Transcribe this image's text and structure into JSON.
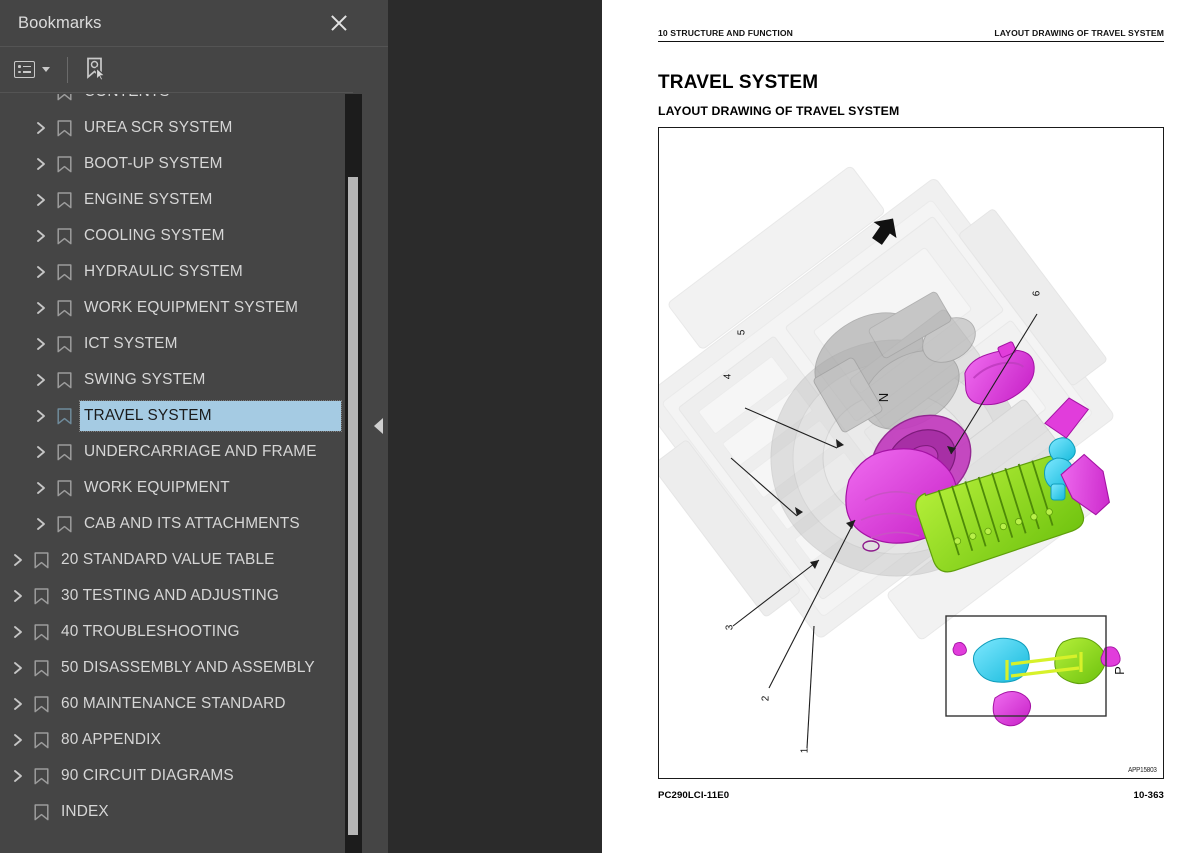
{
  "sidebar": {
    "title": "Bookmarks",
    "close_icon": "close-icon",
    "toolbar": {
      "options_icon": "list-options-icon",
      "caret_icon": "chevron-down-icon",
      "new_bookmark_icon": "new-bookmark-icon"
    },
    "items": [
      {
        "label": "CONTENTS",
        "level": 2,
        "expandable": false,
        "selected": false,
        "clipped": true
      },
      {
        "label": "UREA SCR SYSTEM",
        "level": 2,
        "expandable": true,
        "selected": false
      },
      {
        "label": "BOOT-UP SYSTEM",
        "level": 2,
        "expandable": true,
        "selected": false
      },
      {
        "label": "ENGINE SYSTEM",
        "level": 2,
        "expandable": true,
        "selected": false
      },
      {
        "label": "COOLING SYSTEM",
        "level": 2,
        "expandable": true,
        "selected": false
      },
      {
        "label": "HYDRAULIC SYSTEM",
        "level": 2,
        "expandable": true,
        "selected": false
      },
      {
        "label": "WORK EQUIPMENT SYSTEM",
        "level": 2,
        "expandable": true,
        "selected": false
      },
      {
        "label": "ICT SYSTEM",
        "level": 2,
        "expandable": true,
        "selected": false
      },
      {
        "label": "SWING SYSTEM",
        "level": 2,
        "expandable": true,
        "selected": false
      },
      {
        "label": "TRAVEL SYSTEM",
        "level": 2,
        "expandable": true,
        "selected": true
      },
      {
        "label": "UNDERCARRIAGE AND FRAME",
        "level": 2,
        "expandable": true,
        "selected": false
      },
      {
        "label": "WORK EQUIPMENT",
        "level": 2,
        "expandable": true,
        "selected": false
      },
      {
        "label": "CAB AND ITS ATTACHMENTS",
        "level": 2,
        "expandable": true,
        "selected": false
      },
      {
        "label": "20 STANDARD VALUE TABLE",
        "level": 1,
        "expandable": true,
        "selected": false
      },
      {
        "label": "30 TESTING AND ADJUSTING",
        "level": 1,
        "expandable": true,
        "selected": false
      },
      {
        "label": "40 TROUBLESHOOTING",
        "level": 1,
        "expandable": true,
        "selected": false
      },
      {
        "label": "50 DISASSEMBLY AND ASSEMBLY",
        "level": 1,
        "expandable": true,
        "selected": false
      },
      {
        "label": "60 MAINTENANCE STANDARD",
        "level": 1,
        "expandable": true,
        "selected": false
      },
      {
        "label": "80 APPENDIX",
        "level": 1,
        "expandable": true,
        "selected": false
      },
      {
        "label": "90 CIRCUIT DIAGRAMS",
        "level": 1,
        "expandable": true,
        "selected": false
      },
      {
        "label": "INDEX",
        "level": 1,
        "expandable": false,
        "selected": false
      }
    ],
    "scrollbar": {
      "name": "bookmarks-scrollbar"
    },
    "collapse_handle_icon": "collapse-panel-icon"
  },
  "document": {
    "header_left": "10 STRUCTURE AND FUNCTION",
    "header_right": "LAYOUT DRAWING OF TRAVEL SYSTEM",
    "title": "TRAVEL SYSTEM",
    "subtitle": "LAYOUT DRAWING OF TRAVEL SYSTEM",
    "figure": {
      "code": "APP15803",
      "detail_label": "P",
      "direction_label": "N",
      "callouts": [
        "1",
        "2",
        "3",
        "4",
        "5",
        "6"
      ],
      "colors": {
        "magenta": "#e13ddb",
        "green": "#8ee02a",
        "cyan": "#35d2ef",
        "ghost": "#d8d8d8",
        "line": "#222222"
      }
    },
    "footer_left": "PC290LCI-11E0",
    "footer_right": "10-363"
  }
}
